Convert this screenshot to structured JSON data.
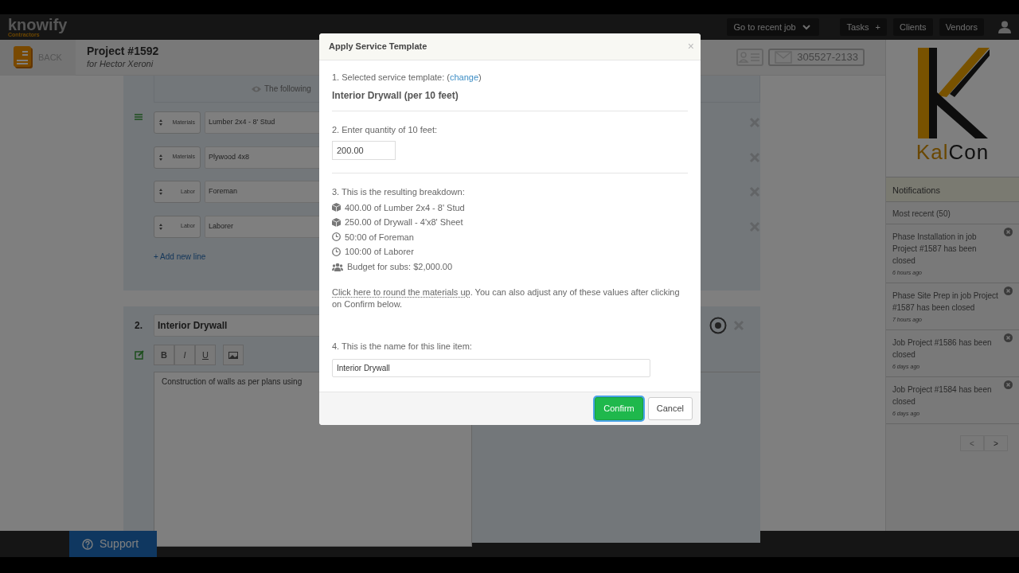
{
  "navbar": {
    "logo": "knowify",
    "logo_sub": "Contractors",
    "recent_job": "Go to recent job",
    "tasks": "Tasks",
    "tasks_add": "+",
    "clients": "Clients",
    "vendors": "Vendors"
  },
  "header": {
    "back": "BACK",
    "title": "Project #1592",
    "subtitle": "for Hector Xeroni",
    "phone": "305527-2133"
  },
  "section_1": {
    "notice": "The following",
    "lines": [
      {
        "type": "Materials",
        "name": "Lumber 2x4 - 8' Stud"
      },
      {
        "type": "Materials",
        "name": "Plywood 4x8"
      },
      {
        "type": "Labor",
        "name": "Foreman"
      },
      {
        "type": "Labor",
        "name": "Laborer"
      }
    ],
    "add_line": "+ Add new line"
  },
  "section_2": {
    "number": "2.",
    "name": "Interior Drywall",
    "toolbar": [
      "B",
      "I",
      "U"
    ],
    "description": "Construction of walls as per plans using"
  },
  "sidebar": {
    "brand_1": "Kal",
    "brand_2": "Con",
    "title": "Notifications",
    "filter": "Most recent (50)",
    "items": [
      {
        "text": "Phase Installation in job Project #1587 has been closed",
        "time": "6 hours ago"
      },
      {
        "text": "Phase Site Prep in job Project #1587 has been closed",
        "time": "7 hours ago"
      },
      {
        "text": "Job Project #1586 has been closed",
        "time": "6 days ago"
      },
      {
        "text": "Job Project #1584 has been closed",
        "time": "6 days ago"
      }
    ],
    "pager": [
      "<",
      ">"
    ]
  },
  "support": "Support",
  "modal": {
    "title": "Apply Service Template",
    "close": "×",
    "step_1": {
      "before": "1. Selected service template: (",
      "link": "change",
      "after": ")"
    },
    "template_name": "Interior Drywall (per 10 feet)",
    "step_2": "2. Enter quantity of 10 feet:",
    "quantity": "200.00",
    "step_3": "3. This is the resulting breakdown:",
    "breakdown": [
      {
        "kind": "material",
        "text": "400.00 of Lumber 2x4 - 8' Stud"
      },
      {
        "kind": "material",
        "text": "250.00 of Drywall - 4'x8' Sheet"
      },
      {
        "kind": "labor",
        "text": "50:00 of Foreman"
      },
      {
        "kind": "labor",
        "text": "100:00 of Laborer"
      },
      {
        "kind": "subs",
        "text": "Budget for subs: $2,000.00"
      }
    ],
    "round_link": "Click here to round the materials up",
    "round_note": ". You can also adjust any of these values after clicking on Confirm below.",
    "step_4": "4. This is the name for this line item:",
    "line_name": "Interior Drywall",
    "confirm": "Confirm",
    "cancel": "Cancel"
  }
}
